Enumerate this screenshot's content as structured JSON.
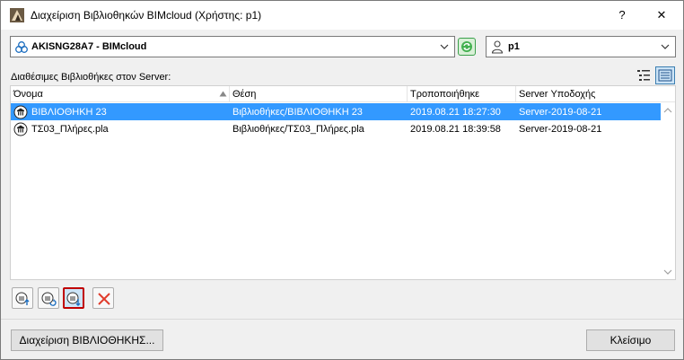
{
  "window": {
    "title": "Διαχείριση Βιβλιοθηκών BIMcloud (Χρήστης: p1)",
    "help": "?",
    "close": "✕"
  },
  "server": {
    "selected": "AKISNG28A7 - BIMcloud"
  },
  "user": {
    "selected": "p1"
  },
  "libraries_label": "Διαθέσιμες Βιβλιοθήκες στον Server:",
  "columns": [
    "Όνομα",
    "Θέση",
    "Τροποποιήθηκε",
    "Server Υποδοχής"
  ],
  "rows": [
    {
      "name": "ΒΙΒΛΙΟΘΗΚΗ 23",
      "location": "Βιβλιοθήκες/ΒΙΒΛΙΟΘΗΚΗ 23",
      "modified": "2019.08.21 18:27:30",
      "host": "Server-2019-08-21",
      "selected": true
    },
    {
      "name": "ΤΣ03_Πλήρες.pla",
      "location": "Βιβλιοθήκες/ΤΣ03_Πλήρες.pla",
      "modified": "2019.08.21 18:39:58",
      "host": "Server-2019-08-21",
      "selected": false
    }
  ],
  "footer": {
    "manage_label": "Διαχείριση ΒΙΒΛΙΟΘΗΚΗΣ...",
    "close_label": "Κλείσιμο"
  },
  "colors": {
    "selection": "#3399ff",
    "highlight_border": "#c00000",
    "delete_red": "#e03c2c",
    "refresh_green": "#3ba04b",
    "accent_blue": "#1e6fc0"
  }
}
